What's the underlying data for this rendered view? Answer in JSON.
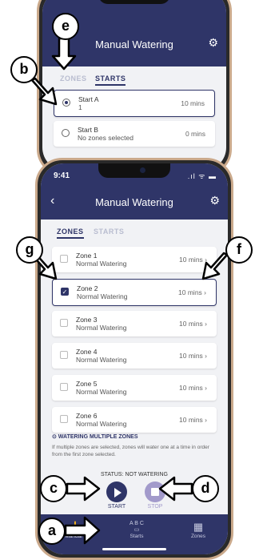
{
  "back_phone": {
    "title": "Manual Watering",
    "tabs": [
      "ZONES",
      "STARTS"
    ],
    "starts": [
      {
        "name": "Start A",
        "detail": "1",
        "duration": "10 mins",
        "selected": true
      },
      {
        "name": "Start B",
        "detail": "No zones selected",
        "duration": "0 mins",
        "selected": false
      }
    ]
  },
  "front_phone": {
    "time": "9:41",
    "status_icons": ".ıl ᯤ ▬",
    "title": "Manual Watering",
    "tabs": [
      "ZONES",
      "STARTS"
    ],
    "zones": [
      {
        "name": "Zone 1",
        "mode": "Normal Watering",
        "duration": "10 mins",
        "checked": false
      },
      {
        "name": "Zone 2",
        "mode": "Normal Watering",
        "duration": "10 mins",
        "checked": true
      },
      {
        "name": "Zone 3",
        "mode": "Normal Watering",
        "duration": "10 mins",
        "checked": false
      },
      {
        "name": "Zone 4",
        "mode": "Normal Watering",
        "duration": "10 mins",
        "checked": false
      },
      {
        "name": "Zone 5",
        "mode": "Normal Watering",
        "duration": "10 mins",
        "checked": false
      },
      {
        "name": "Zone 6",
        "mode": "Normal Watering",
        "duration": "10 mins",
        "checked": false
      }
    ],
    "info_heading": "⊙ WATERING MULTIPLE ZONES",
    "info_text": "If multiple zones are selected, zones will water one at a time in order from the first zone selected.",
    "status": "STATUS: NOT WATERING",
    "start_label": "START",
    "stop_label": "STOP",
    "bottom_tabs": [
      {
        "label": "Manual",
        "icon": "hand-pointer-icon",
        "active": true
      },
      {
        "label": "Starts",
        "icon": "abc-starts-icon",
        "active": false
      },
      {
        "label": "Zones",
        "icon": "zones-icon",
        "active": false
      }
    ],
    "starts_glyph": "A B C"
  },
  "callouts": {
    "a": "a",
    "b": "b",
    "c": "c",
    "d": "d",
    "e": "e",
    "f": "f",
    "g": "g"
  },
  "colors": {
    "primary": "#2f3568",
    "accent_stop": "#a29acb",
    "frame": "#caa98b"
  }
}
